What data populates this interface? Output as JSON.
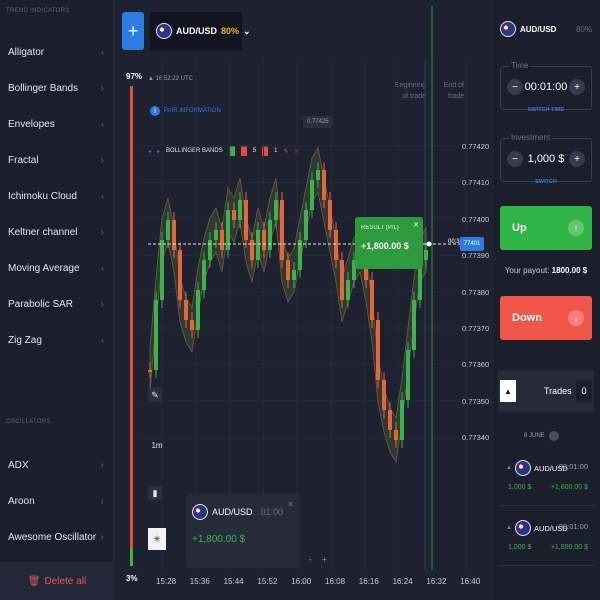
{
  "sidebar": {
    "trend_title": "TREND INDICATORS",
    "trend_items": [
      "Alligator",
      "Bollinger Bands",
      "Envelopes",
      "Fractal",
      "Ichimoku Cloud",
      "Keltner channel",
      "Moving Average",
      "Parabolic SAR",
      "Zig Zag"
    ],
    "osc_title": "OSCILLATORS",
    "osc_items": [
      "ADX",
      "Aroon",
      "Awesome Oscillator"
    ],
    "delete_all": "Delete all"
  },
  "header": {
    "add_label": "+",
    "asset": "AUD/USD",
    "payout_pct": "80%"
  },
  "chart": {
    "clock": "16:52:22 UTC",
    "pair_info": "PAIR INFORMATION",
    "indicator_name": "BOLLINGER BANDS",
    "indicator_p1": "5",
    "indicator_p2": "1",
    "begin_label": "Beginning of trade",
    "end_label": "End of trade",
    "price_marker": "0.77425",
    "pct_top": "97%",
    "pct_bottom": "3%",
    "countdown": "00:38",
    "current_price": "77401",
    "y_ticks": [
      "0.77420",
      "0.77410",
      "0.77400",
      "0.77390",
      "0.77380",
      "0.77370",
      "0.77360",
      "0.77350",
      "0.77340"
    ],
    "x_ticks": [
      "15:28",
      "15:36",
      "15:44",
      "15:52",
      "16:00",
      "16:08",
      "16:16",
      "16:24",
      "16:32",
      "16:40"
    ],
    "result_title": "RESULT (P/L)",
    "result_value": "+1,800.00 $",
    "zoom_minus": "-",
    "zoom_plus": "+",
    "timeframe": "1m",
    "colors": {
      "up": "#3bb54a",
      "down": "#e8643a",
      "band": "#4a6b3a"
    }
  },
  "trade_card": {
    "asset": "AUD/USD",
    "time": "01:00",
    "value": "+1,800.00 $"
  },
  "right_panel": {
    "asset": "AUD/USD",
    "payout_pct": "80%",
    "time_label": "Time",
    "time_value": "00:01:00",
    "time_switch": "SWITCH TIME",
    "investment_label": "Investment",
    "investment_value": "1,000 $",
    "investment_switch": "SWITCH",
    "up_label": "Up",
    "payout_label": "Your payout:",
    "payout_value": "1800.00 $",
    "down_label": "Down",
    "trades_label": "Trades",
    "trades_count": "0",
    "day_label": "8 JUNE",
    "trades": [
      {
        "asset": "AUD/USD",
        "time": "00:01:00",
        "amount": "1,000 $",
        "pl": "+1,800.00 $"
      },
      {
        "asset": "AUD/USD",
        "time": "00:01:00",
        "amount": "1,000 $",
        "pl": "+1,800.00 $"
      }
    ]
  }
}
